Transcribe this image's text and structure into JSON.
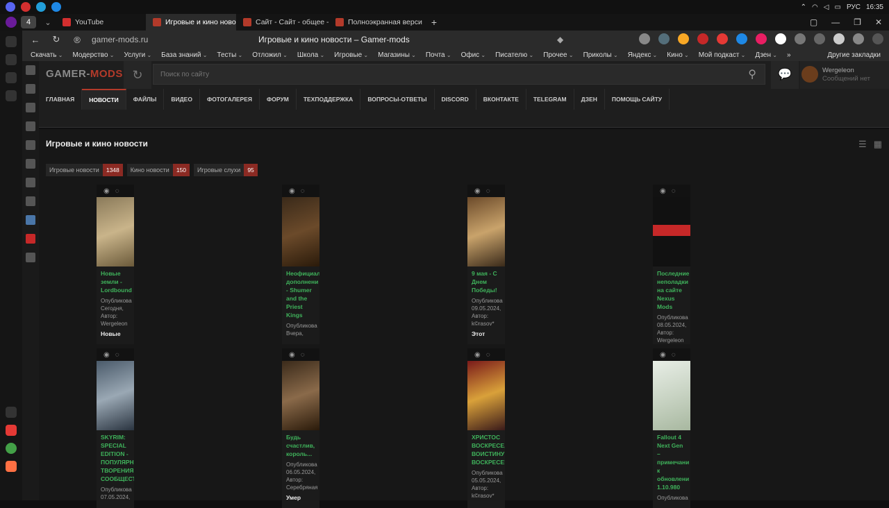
{
  "os": {
    "tray_lang": "РУС",
    "tray_time": "16:35"
  },
  "browser": {
    "tab_count": "4",
    "tabs": [
      {
        "label": "YouTube",
        "color": "#d32f2f"
      },
      {
        "label": "Игровые и кино новос",
        "color": "#b33a2a"
      },
      {
        "label": "Сайт - Сайт - общее - Фор",
        "color": "#b33a2a"
      },
      {
        "label": "Полноэкранная версия с",
        "color": "#b33a2a"
      }
    ],
    "url": "gamer-mods.ru",
    "page_title": "Игровые и кино новости – Gamer-mods",
    "bookmarks": [
      "Скачать",
      "Модерство",
      "Услуги",
      "База знаний",
      "Тесты",
      "Отложил",
      "Школа",
      "Игровые",
      "Магазины",
      "Почта",
      "Офис",
      "Писателю",
      "Прочее",
      "Приколы",
      "Яндекс",
      "Кино",
      "Мой подкаст",
      "Дзен"
    ],
    "other_bookmarks": "Другие закладки",
    "more": "»"
  },
  "site": {
    "logo_main": "GAMER-",
    "logo_accent": "MODS",
    "search_placeholder": "Поиск по сайту",
    "user_name": "Wergeleon",
    "user_status": "Сообщений нет",
    "nav": [
      "ГЛАВНАЯ",
      "НОВОСТИ",
      "ФАЙЛЫ",
      "ВИДЕО",
      "ФОТОГАЛЕРЕЯ",
      "ФОРУМ",
      "ТЕХПОДДЕРЖКА",
      "ВОПРОСЫ-ОТВЕТЫ",
      "DISCORD",
      "ВКОНТАКТЕ",
      "TELEGRAM",
      "ДЗЕН",
      "ПОМОЩЬ САЙТУ"
    ],
    "active_nav": "НОВОСТИ",
    "heading": "Игровые и кино новости",
    "categories": [
      {
        "label": "Игровые новости",
        "count": "1348"
      },
      {
        "label": "Кино новости",
        "count": "150"
      },
      {
        "label": "Игровые слухи",
        "count": "95"
      }
    ],
    "cards": [
      {
        "title": "Новые земли - Lordbound",
        "meta": "Опубликова Сегодня, Автор: Wergeleon",
        "desc": "Новые"
      },
      {
        "title": "Неофициал дополнени - Shumer and the Priest Kings",
        "meta": "Опубликова Вчера,",
        "desc": ""
      },
      {
        "title": "9 мая - С Днем Победы!",
        "meta": "Опубликова 09.05.2024, Автор: k©rasov*",
        "desc": "Этот"
      },
      {
        "title": "Последние неполадки на сайте Nexus Mods",
        "meta": "Опубликова 08.05.2024, Автор: Wergeleon",
        "desc": ""
      },
      {
        "title": "SKYRIM: SPECIAL EDITION - ПОПУЛЯРН ТВОРЕНИЯ СООБЩЕСТ",
        "meta": "Опубликова 07.05.2024,",
        "desc": ""
      },
      {
        "title": "Будь счастлив, король...",
        "meta": "Опубликова 06.05.2024, Автор: Серебряная",
        "desc": "Умер"
      },
      {
        "title": "ХРИСТОС ВОСКРЕСЕ, ВОИСТИНУ ВОСКРЕСЕ!",
        "meta": "Опубликова 05.05.2024, Автор: k©rasov*",
        "desc": ""
      },
      {
        "title": "Fallout 4 Next Gen – примечани к обновлени 1.10.980",
        "meta": "Опубликова",
        "desc": ""
      }
    ]
  }
}
